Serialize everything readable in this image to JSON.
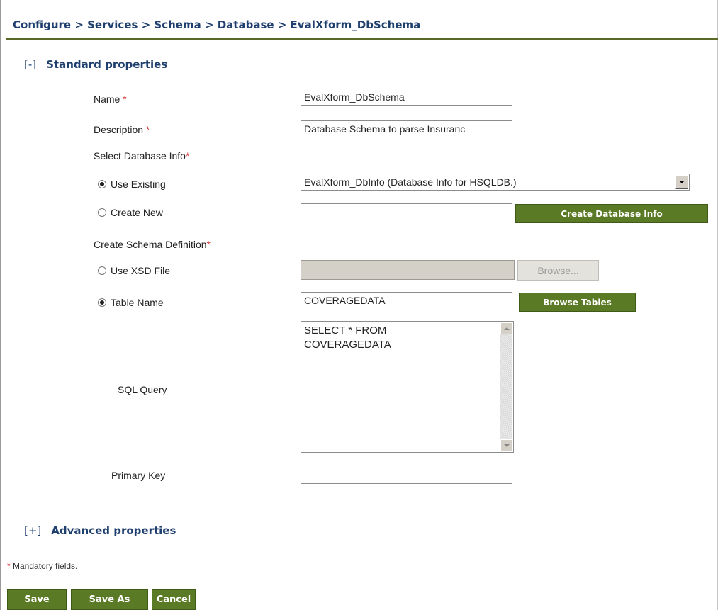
{
  "breadcrumb": "Configure > Services > Schema > Database > EvalXform_DbSchema",
  "standard": {
    "toggle": "[-]",
    "title": "Standard properties"
  },
  "fields": {
    "name": {
      "label": "Name",
      "value": "EvalXform_DbSchema"
    },
    "description": {
      "label": "Description",
      "value": "Database Schema to parse Insuranc"
    },
    "select_db_info": {
      "label": "Select Database Info"
    },
    "use_existing": {
      "label": "Use Existing",
      "value": "EvalXform_DbInfo (Database Info for HSQLDB.)"
    },
    "create_new": {
      "label": "Create New",
      "value": "",
      "button": "Create Database Info"
    },
    "create_schema_def": {
      "label": "Create Schema Definition"
    },
    "use_xsd": {
      "label": "Use XSD File",
      "value": "",
      "button": "Browse..."
    },
    "table_name": {
      "label": "Table Name",
      "value": "COVERAGEDATA",
      "button": "Browse Tables"
    },
    "sql_query": {
      "label": "SQL Query",
      "value": "SELECT * FROM\nCOVERAGEDATA"
    },
    "primary_key": {
      "label": "Primary Key",
      "value": ""
    }
  },
  "advanced": {
    "toggle": "[+]",
    "title": "Advanced properties"
  },
  "required_marker": "*",
  "mandatory_note": "Mandatory fields.",
  "footer": {
    "save": "Save",
    "save_as": "Save As",
    "cancel": "Cancel"
  },
  "colors": {
    "accent_green": "#5a7a26",
    "title_blue": "#1f3f6e",
    "required_red": "#d83a3a"
  }
}
